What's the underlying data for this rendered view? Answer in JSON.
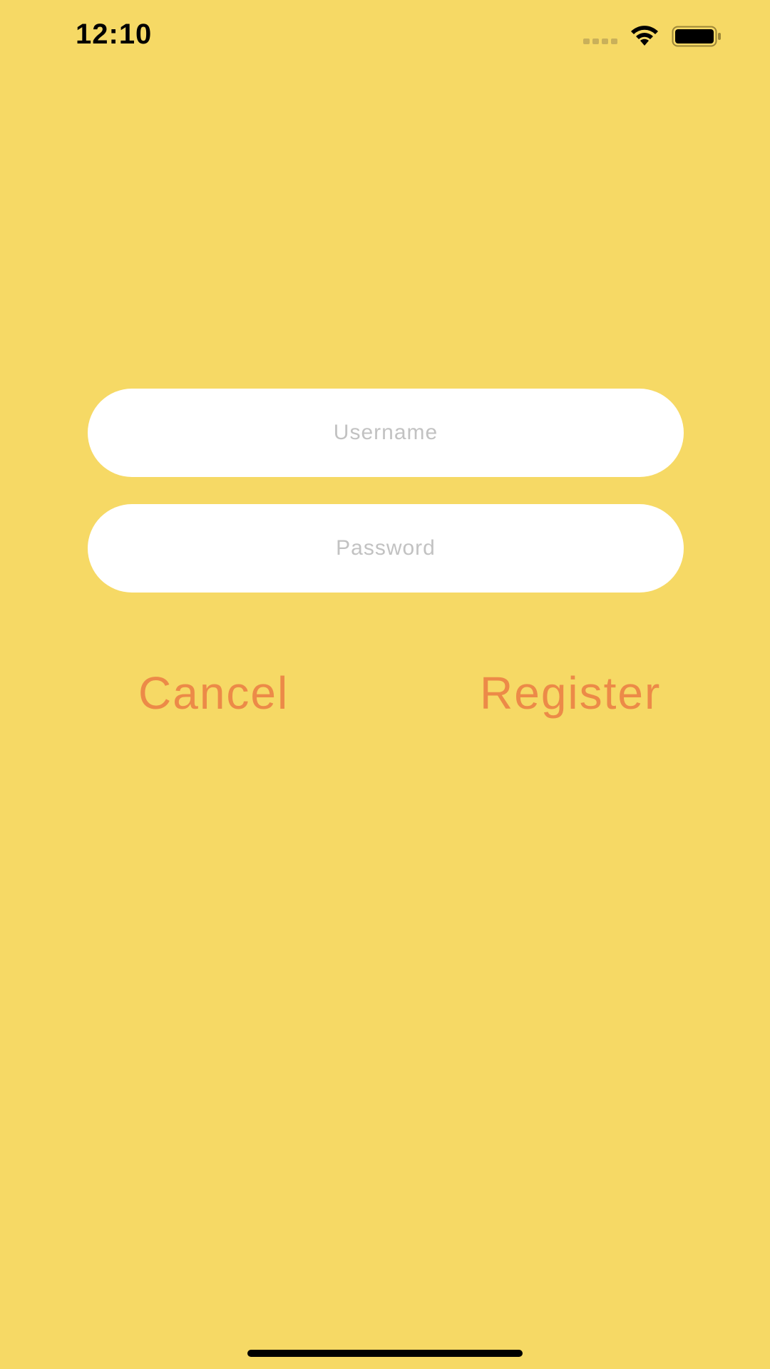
{
  "status_bar": {
    "time": "12:10",
    "icons": [
      "cellular-signal-icon",
      "wifi-icon",
      "battery-icon"
    ]
  },
  "form": {
    "username": {
      "value": "",
      "placeholder": "Username"
    },
    "password": {
      "value": "",
      "placeholder": "Password"
    }
  },
  "actions": {
    "cancel_label": "Cancel",
    "register_label": "Register"
  },
  "colors": {
    "background": "#F6D965",
    "field_background": "#FFFFFF",
    "placeholder": "#C2C2C2",
    "accent": "#EC8A48",
    "status_text": "#000000"
  }
}
